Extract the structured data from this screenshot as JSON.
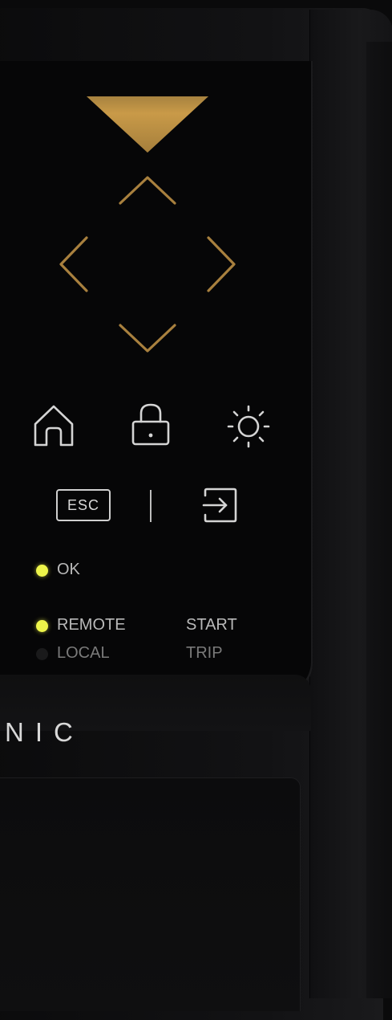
{
  "colors": {
    "accent": "#c89a45",
    "led_on": "#eef54a",
    "icon": "#cfcfcf"
  },
  "nav": {
    "primary": "triangle-down-icon",
    "up": "chevron-up-icon",
    "left": "chevron-left-icon",
    "right": "chevron-right-icon",
    "down": "chevron-down-icon"
  },
  "function_keys": [
    "home-icon",
    "lock-icon",
    "brightness-icon"
  ],
  "esc_label": "ESC",
  "enter_icon": "enter-icon",
  "status": {
    "ok": {
      "label": "OK",
      "led": "on"
    },
    "remote": {
      "label": "REMOTE",
      "led": "on"
    },
    "local": {
      "label": "LOCAL",
      "led": "off"
    },
    "start": {
      "label": "START"
    },
    "trip": {
      "label": "TRIP"
    }
  },
  "brand": "NIC"
}
